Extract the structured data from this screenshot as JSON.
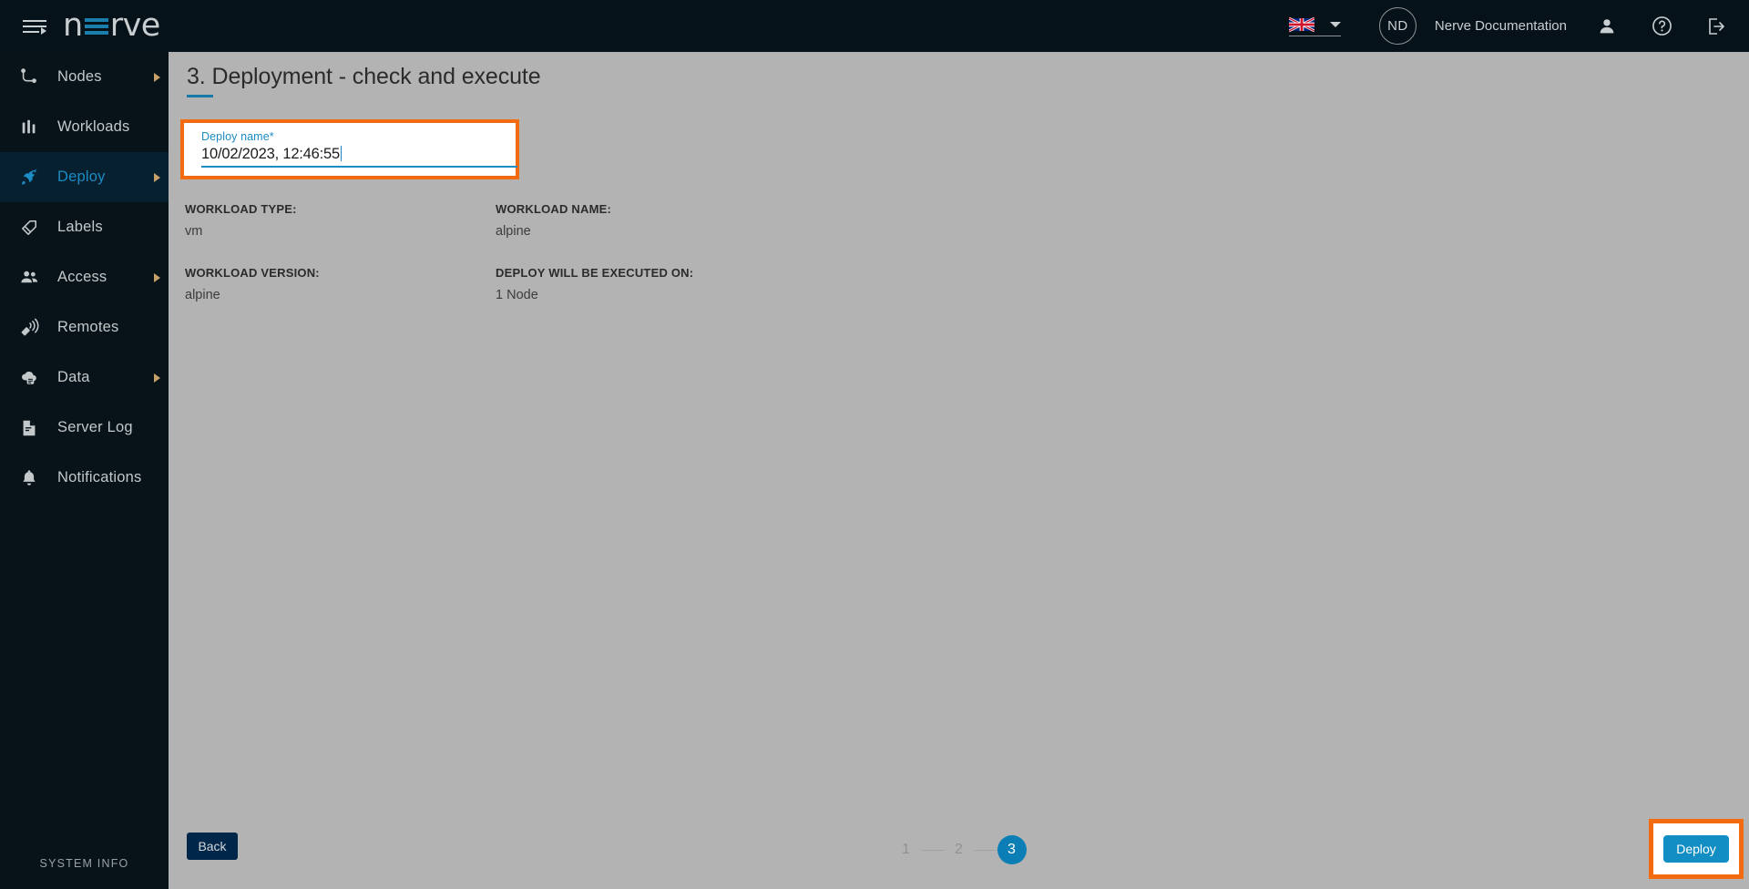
{
  "topbar": {
    "menu_icon": "hamburger-menu-icon",
    "logo_text": "nerve",
    "logo_parts": {
      "pre": "n",
      "post": "rve"
    },
    "language": {
      "flag": "uk-flag-icon",
      "selected": "English",
      "chevron": "chevron-down-icon"
    },
    "avatar_initials": "ND",
    "username": "Nerve Documentation",
    "icons": [
      "user-icon",
      "help-icon",
      "logout-icon"
    ]
  },
  "sidebar": {
    "items": [
      {
        "label": "Nodes",
        "icon": "nodes-icon",
        "has_arrow": true,
        "active": false
      },
      {
        "label": "Workloads",
        "icon": "workloads-icon",
        "has_arrow": false,
        "active": false
      },
      {
        "label": "Deploy",
        "icon": "rocket-icon",
        "has_arrow": true,
        "active": true
      },
      {
        "label": "Labels",
        "icon": "tag-icon",
        "has_arrow": false,
        "active": false
      },
      {
        "label": "Access",
        "icon": "users-icon",
        "has_arrow": true,
        "active": false
      },
      {
        "label": "Remotes",
        "icon": "remote-icon",
        "has_arrow": false,
        "active": false
      },
      {
        "label": "Data",
        "icon": "cloud-data-icon",
        "has_arrow": true,
        "active": false
      },
      {
        "label": "Server Log",
        "icon": "document-icon",
        "has_arrow": false,
        "active": false
      },
      {
        "label": "Notifications",
        "icon": "bell-icon",
        "has_arrow": false,
        "active": false
      }
    ],
    "system_info": "SYSTEM INFO"
  },
  "main": {
    "page_title": "3. Deployment - check and execute",
    "deploy_name": {
      "label": "Deploy name*",
      "value": "10/02/2023, 12:46:55",
      "placeholder": "Deploy name"
    },
    "info": [
      [
        {
          "key": "WORKLOAD TYPE:",
          "value": "vm"
        },
        {
          "key": "WORKLOAD NAME:",
          "value": "alpine"
        }
      ],
      [
        {
          "key": "WORKLOAD VERSION:",
          "value": "alpine"
        },
        {
          "key": "DEPLOY WILL BE EXECUTED ON:",
          "value": "1 Node"
        }
      ]
    ],
    "footer": {
      "back_label": "Back",
      "deploy_label": "Deploy",
      "steps": [
        "1",
        "2",
        "3"
      ],
      "active_step": "3"
    }
  },
  "colors": {
    "accent_blue": "#138ec4",
    "highlight_orange": "#f36b10",
    "sidebar_bg": "#071318",
    "topbar_bg": "#061219",
    "content_bg": "#b3b3b3",
    "back_button_bg": "#00274a"
  }
}
